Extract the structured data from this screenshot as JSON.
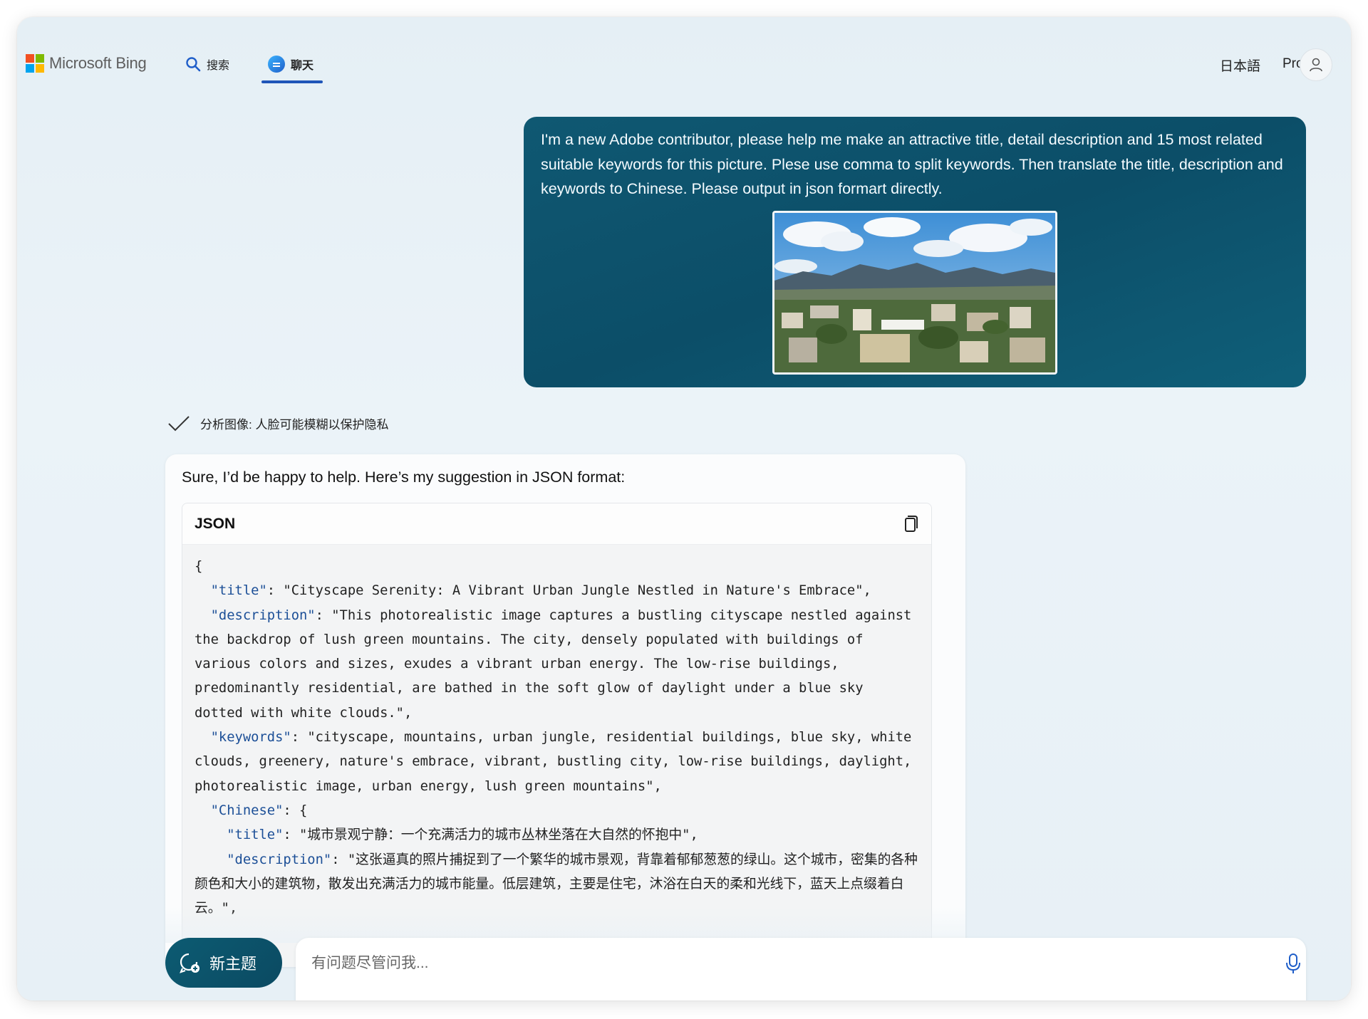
{
  "header": {
    "brand": "Microsoft Bing",
    "tabs": [
      {
        "label": "搜索",
        "icon": "search-icon"
      },
      {
        "label": "聊天",
        "icon": "chat-icon",
        "active": true
      }
    ],
    "language": "日本語",
    "pro": "Pro"
  },
  "user_message": {
    "text": "I'm a new Adobe contributor, please help me make an attractive title, detail description and 15 most related suitable keywords for this picture. Plese use comma to split keywords. Then translate the title, description and keywords to Chinese. Please output in json formart directly."
  },
  "analysis": {
    "text": "分析图像: 人脸可能模糊以保护隐私"
  },
  "bot_message": {
    "intro": "Sure, I’d be happy to help. Here’s my suggestion in JSON format:",
    "code_language": "JSON",
    "code": {
      "open": "{",
      "title_key": "\"title\"",
      "title_value": ": \"Cityscape Serenity: A Vibrant Urban Jungle Nestled in Nature's Embrace\",",
      "description_key": "\"description\"",
      "description_value": ": \"This photorealistic image captures a bustling cityscape nestled against the backdrop of lush green mountains. The city, densely populated with buildings of various colors and sizes, exudes a vibrant urban energy. The low-rise buildings, predominantly residential, are bathed in the soft glow of daylight under a blue sky dotted with white clouds.\",",
      "keywords_key": "\"keywords\"",
      "keywords_value": ": \"cityscape, mountains, urban jungle, residential buildings, blue sky, white clouds, greenery, nature's embrace, vibrant, bustling city, low-rise buildings, daylight, photorealistic image, urban energy, lush green mountains\",",
      "chinese_key": "\"Chinese\"",
      "chinese_open": ": {",
      "cn_title_key": "\"title\"",
      "cn_title_value": ": \"城市景观宁静：一个充满活力的城市丛林坐落在大自然的怀抱中\",",
      "cn_description_key": "\"description\"",
      "cn_description_value": ": \"这张逼真的照片捕捉到了一个繁华的城市景观，背靠着郁郁葱葱的绿山。这个城市，密集的各种颜色和大小的建筑物，散发出充满活力的城市能量。低层建筑，主要是住宅，沐浴在白天的柔和光线下，蓝天上点缀着白云。\","
    }
  },
  "bottom": {
    "new_topic": "新主题",
    "input_placeholder": "有问题尽管问我..."
  },
  "colors": {
    "user_bubble": "#0d5670",
    "json_key": "#1c4f97",
    "nav_underline": "#1f55b8"
  }
}
